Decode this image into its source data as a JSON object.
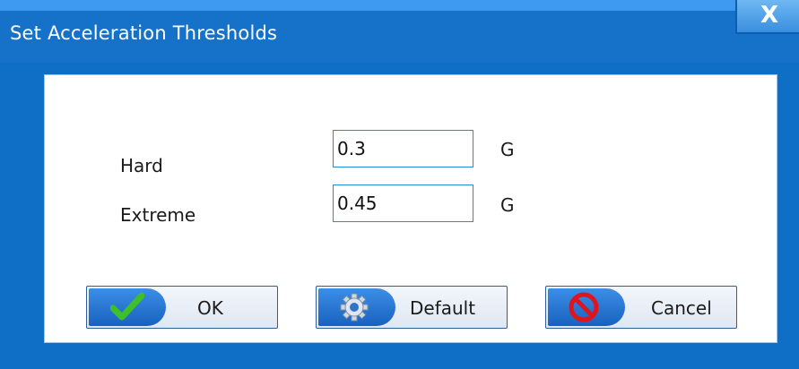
{
  "window": {
    "title": "Set Acceleration Thresholds",
    "close_glyph": "X"
  },
  "fields": {
    "hard": {
      "label": "Hard",
      "value": "0.3",
      "unit": "G"
    },
    "extreme": {
      "label": "Extreme",
      "value": "0.45",
      "unit": "G"
    }
  },
  "buttons": {
    "ok": {
      "label": "OK",
      "icon": "checkmark-icon"
    },
    "default": {
      "label": "Default",
      "icon": "gear-icon"
    },
    "cancel": {
      "label": "Cancel",
      "icon": "no-entry-icon"
    }
  },
  "colors": {
    "frame": "#0f6ec6",
    "field_border": "#1f8fd6",
    "button_icon_bg": "#1862bf"
  }
}
